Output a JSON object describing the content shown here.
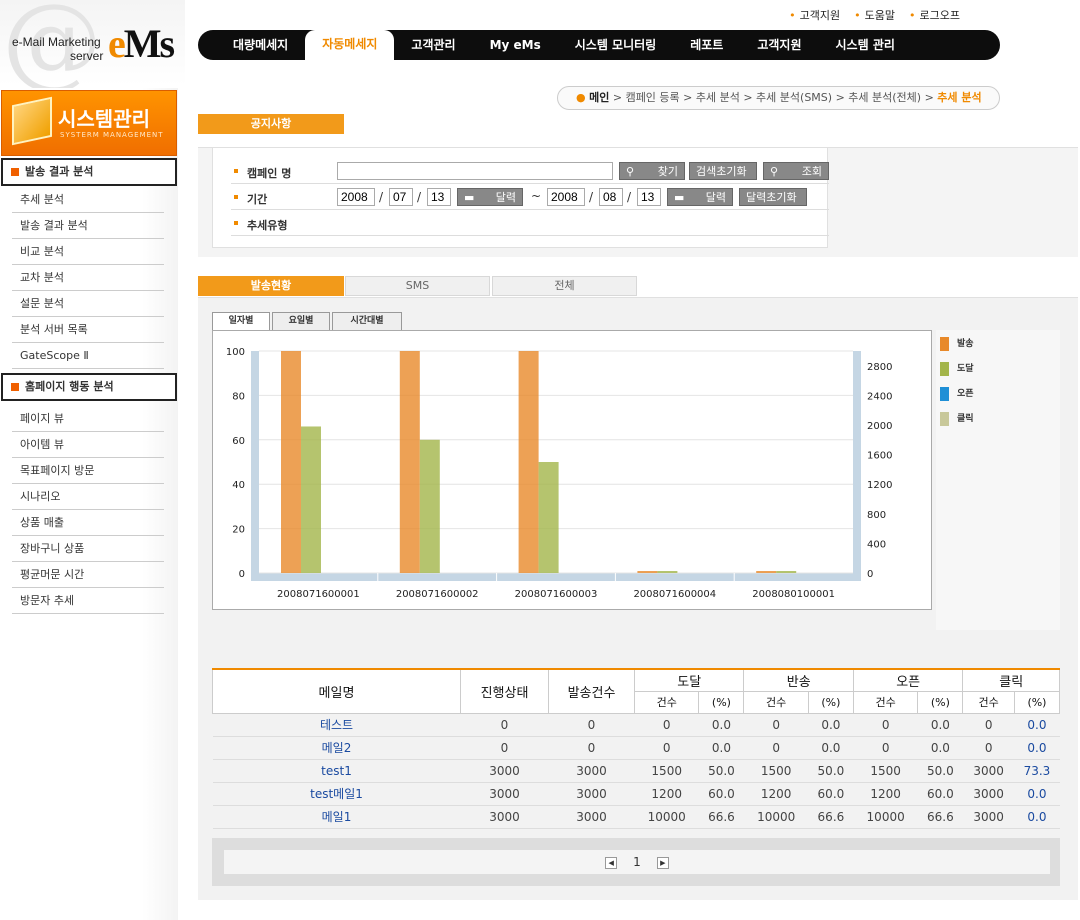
{
  "logo": {
    "line1": "e-Mail Marketing",
    "line2": "server",
    "brand_a": "e",
    "brand_b": "Ms"
  },
  "top_links": [
    "고객지원",
    "도움말",
    "로그오프"
  ],
  "gnb": [
    "대량메세지",
    "자동메세지",
    "고객관리",
    "My eMs",
    "시스템 모니터링",
    "레포트",
    "고객지원",
    "시스템 관리"
  ],
  "sidebar": {
    "title": "시스템관리",
    "title_en": "SYSTERM MANAGEMENT",
    "sec1": "발송 결과 분석",
    "sec1_items": [
      "추세 분석",
      "발송 결과 분석",
      "비교 분석",
      "교차 분석",
      "설문 분석",
      "분석 서버 목록",
      "GateScope Ⅱ"
    ],
    "sec2": "홈페이지 행동 분석",
    "sec2_items": [
      "페이지 뷰",
      "아이템 뷰",
      "목표페이지 방문",
      "시나리오",
      "상품 매출",
      "장바구니 상품",
      "평균머문 시간",
      "방문자 추세"
    ]
  },
  "breadcrumb": {
    "home": "메인",
    "path": " > 캠페인 등록 > 추세 분석 > 추세 분석(SMS) > 추세 분석(전체) > ",
    "current": "추세 분석"
  },
  "notice_tab": "공지사항",
  "search": {
    "campaign_label": "캠페인 명",
    "campaign_value": "",
    "find_btn": "찾기",
    "reset_btn": "검색초기화",
    "query_btn": "조회",
    "period_label": "기간",
    "from_y": "2008",
    "from_m": "07",
    "from_d": "13",
    "to_y": "2008",
    "to_m": "08",
    "to_d": "13",
    "cal_btn": "달력",
    "cal_reset": "달력초기화",
    "tilde": "~",
    "slash": "/",
    "trend_label": "추세유형"
  },
  "main_tabs": [
    "발송현황",
    "SMS",
    "전체"
  ],
  "chart_tabs": [
    "일자별",
    "요일별",
    "시간대별"
  ],
  "legend": [
    {
      "label": "발송",
      "color": "#e8892a"
    },
    {
      "label": "도달",
      "color": "#a3b54a"
    },
    {
      "label": "오픈",
      "color": "#1f8fd6"
    },
    {
      "label": "클릭",
      "color": "#c8c89a"
    }
  ],
  "chart_data": {
    "type": "bar",
    "categories": [
      "2008071600001",
      "2008071600002",
      "2008071600003",
      "2008071600004",
      "2008080100001"
    ],
    "series": [
      {
        "name": "발송",
        "values": [
          100,
          100,
          100,
          0,
          0
        ]
      },
      {
        "name": "도달",
        "values": [
          66,
          60,
          50,
          0,
          0
        ]
      }
    ],
    "ylim": [
      0,
      100
    ],
    "yticks": [
      0,
      20,
      40,
      60,
      80,
      100
    ],
    "y2lim": [
      0,
      3000
    ],
    "y2ticks": [
      0,
      400,
      800,
      1200,
      1600,
      2000,
      2400,
      2800
    ]
  },
  "table": {
    "headers": [
      "메일명",
      "진행상태",
      "발송건수",
      "도달",
      "반송",
      "오픈",
      "클릭"
    ],
    "sub": [
      "건수",
      "(%)"
    ],
    "rows": [
      [
        "테스트",
        "0",
        "0",
        "0",
        "0.0",
        "0",
        "0.0",
        "0",
        "0.0",
        "0",
        "0.0"
      ],
      [
        "메일2",
        "0",
        "0",
        "0",
        "0.0",
        "0",
        "0.0",
        "0",
        "0.0",
        "0",
        "0.0"
      ],
      [
        "test1",
        "3000",
        "3000",
        "1500",
        "50.0",
        "1500",
        "50.0",
        "1500",
        "50.0",
        "3000",
        "73.3"
      ],
      [
        "test메일1",
        "3000",
        "3000",
        "1200",
        "60.0",
        "1200",
        "60.0",
        "1200",
        "60.0",
        "3000",
        "0.0"
      ],
      [
        "메일1",
        "3000",
        "3000",
        "10000",
        "66.6",
        "10000",
        "66.6",
        "10000",
        "66.6",
        "3000",
        "0.0"
      ]
    ]
  },
  "pager": {
    "prev": "◀",
    "page": "1",
    "next": "▶"
  }
}
